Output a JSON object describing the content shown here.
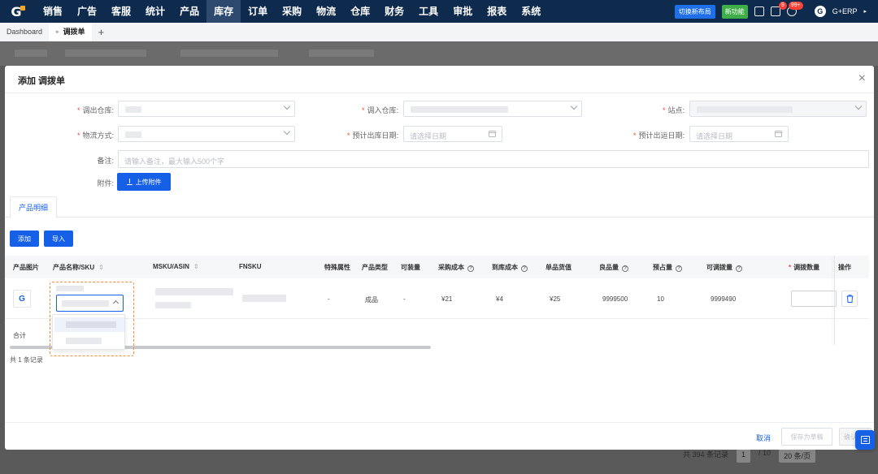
{
  "nav": {
    "menu": [
      "销售",
      "广告",
      "客服",
      "统计",
      "产品",
      "库存",
      "订单",
      "采购",
      "物流",
      "仓库",
      "财务",
      "工具",
      "审批",
      "报表",
      "系统"
    ],
    "active_index": 5,
    "switch_label": "切换新布局",
    "new_feature": "新功能",
    "msg_badge": "9",
    "bell_badge": "99+",
    "user": "G+ERP"
  },
  "tabs": {
    "dashboard": "Dashboard",
    "active": "调拨单",
    "add": "+"
  },
  "modal": {
    "title": "添加 调拨单",
    "close": "×",
    "fields": {
      "out_wh": "调出仓库:",
      "in_wh": "调入仓库:",
      "site": "站点:",
      "logistics": "物流方式:",
      "est_out_date": "预计出库日期:",
      "est_ship_date": "预计出运日期:",
      "remark": "备注:",
      "attachment": "附件:"
    },
    "date_placeholder": "请选择日期",
    "remark_placeholder": "请输入备注，最大输入500个字",
    "upload_label": "上传附件",
    "section_tab": "产品明细",
    "add_btn": "添加",
    "import_btn": "导入",
    "columns": [
      "产品图片",
      "产品名称/SKU",
      "MSKU/ASIN",
      "FNSKU",
      "特殊属性",
      "产品类型",
      "可装量",
      "采购成本",
      "到库成本",
      "单品货值",
      "良品量",
      "预占量",
      "可调拨量",
      "调拨数量",
      "操作"
    ],
    "row": {
      "special": "-",
      "type": "成品",
      "capacity": "-",
      "purchase_cost": "¥21",
      "arrival_cost": "¥4",
      "unit_value": "¥25",
      "good_qty": "9999500",
      "reserved": "10",
      "transferable": "9999490"
    },
    "sum_label": "合计",
    "records": "共 1 条记录",
    "footer": {
      "cancel": "取消",
      "save_draft": "保存为草稿",
      "confirm": "确认"
    }
  },
  "bg_footer": {
    "total": "共 394 条记录",
    "page": "1",
    "pages": "/ 10",
    "size": "20 条/页"
  },
  "colors": {
    "nav_bg": "#0e2a4d",
    "primary": "#1660e8",
    "required": "#f0463c",
    "highlight_outline": "#f08c3c"
  }
}
